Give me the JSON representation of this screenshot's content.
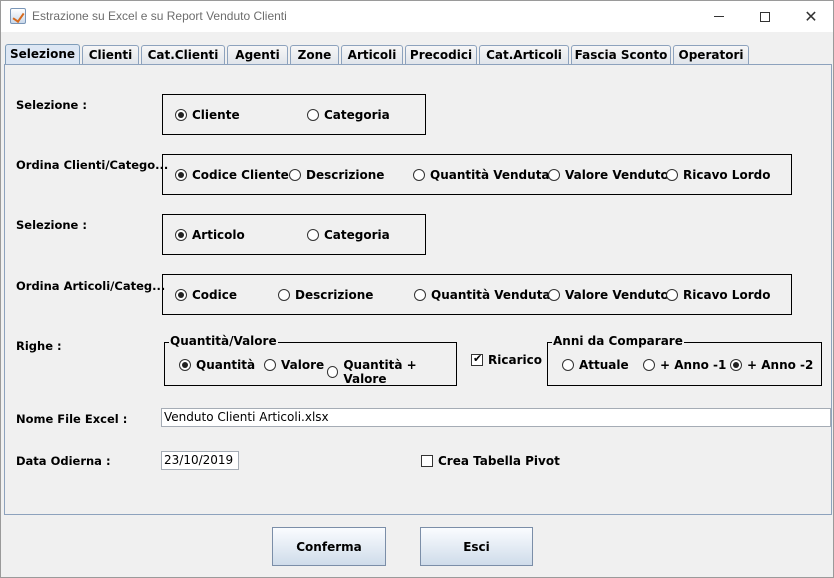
{
  "window": {
    "title": "Estrazione su Excel e su Report Venduto Clienti"
  },
  "tabs": [
    "Selezione",
    "Clienti",
    "Cat.Clienti",
    "Agenti",
    "Zone",
    "Articoli",
    "Precodici",
    "Cat.Articoli",
    "Fascia Sconto",
    "Operatori"
  ],
  "active_tab": "Selezione",
  "rows": {
    "sel_clienti": {
      "label": "Selezione :",
      "options": [
        "Cliente",
        "Categoria"
      ],
      "selected": "Cliente"
    },
    "ord_clienti": {
      "label": "Ordina Clienti/Catego...",
      "options": [
        "Codice Cliente",
        "Descrizione",
        "Quantità Venduta",
        "Valore Venduto",
        "Ricavo Lordo"
      ],
      "selected": "Codice Cliente"
    },
    "sel_articoli": {
      "label": "Selezione :",
      "options": [
        "Articolo",
        "Categoria"
      ],
      "selected": "Articolo"
    },
    "ord_articoli": {
      "label": "Ordina Articoli/Categ...",
      "options": [
        "Codice",
        "Descrizione",
        "Quantità Venduta",
        "Valore Venduto",
        "Ricavo Lordo"
      ],
      "selected": "Codice"
    },
    "righe": {
      "label": "Righe :",
      "qv_title": "Quantità/Valore",
      "qv_options": [
        "Quantità",
        "Valore",
        "Quantità + Valore"
      ],
      "qv_selected": "Quantità",
      "ricarico_label": "Ricarico",
      "ricarico_checked": true,
      "anni_title": "Anni da Comparare",
      "anni_options": [
        "Attuale",
        "+ Anno -1",
        "+ Anno -2"
      ],
      "anni_selected": "+ Anno -2"
    }
  },
  "nome_file": {
    "label": "Nome File Excel :",
    "value": "Venduto Clienti Articoli.xlsx"
  },
  "data_odierna": {
    "label": "Data Odierna :",
    "value": "23/10/2019"
  },
  "pivot": {
    "label": "Crea Tabella Pivot",
    "checked": false
  },
  "buttons": {
    "confirm": "Conferma",
    "exit": "Esci"
  }
}
